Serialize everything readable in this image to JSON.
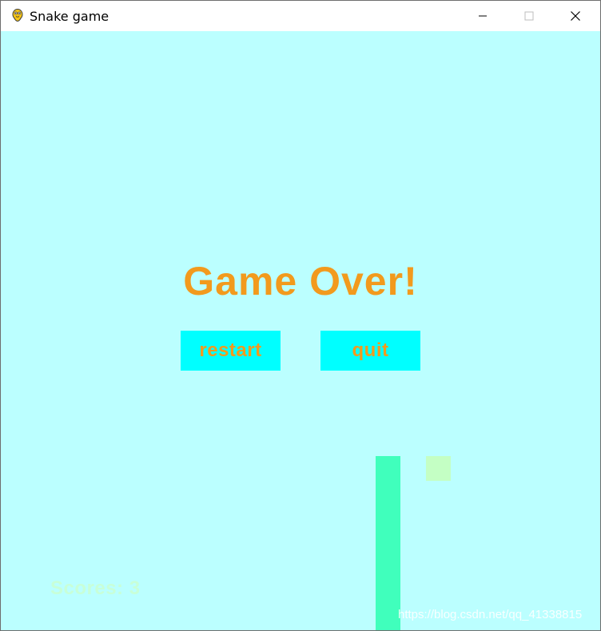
{
  "window": {
    "title": "Snake game",
    "icons": {
      "app": "python-snake-icon",
      "minimize": "minimize-icon",
      "maximize": "maximize-icon",
      "close": "close-icon"
    }
  },
  "game": {
    "background_color": "#bbffff",
    "game_over_text": "Game Over!",
    "text_color": "#f29a1d",
    "buttons": {
      "restart_label": "restart",
      "quit_label": "quit",
      "button_color": "#00ffff"
    },
    "score_text": "Scores: 3",
    "snake_color": "#40ffbc",
    "food_color": "#c4ffc4"
  },
  "watermark": "https://blog.csdn.net/qq_41338815"
}
